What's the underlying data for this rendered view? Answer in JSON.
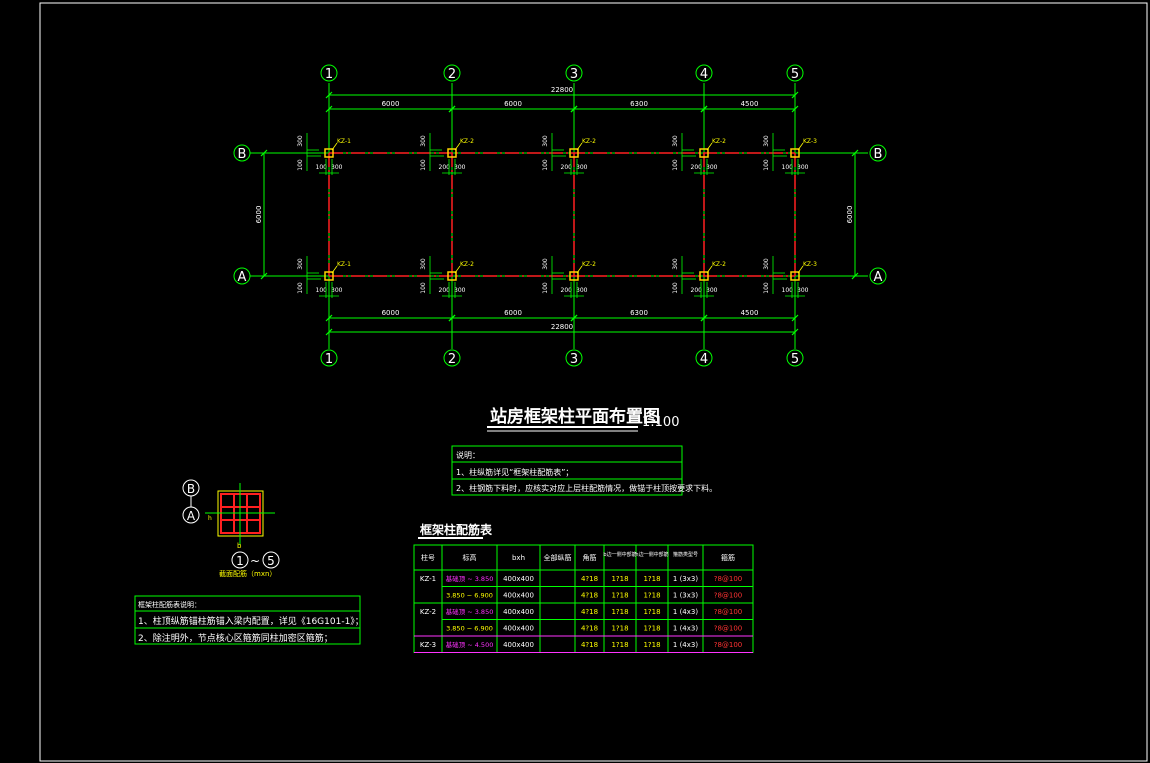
{
  "drawing": {
    "title": "站房框架柱平面布置图",
    "scale": "1:100",
    "axes_x": [
      "1",
      "2",
      "3",
      "4",
      "5"
    ],
    "axes_y": [
      "B",
      "A"
    ],
    "x_spans": [
      "6000",
      "6000",
      "6300",
      "4500"
    ],
    "x_total": "22800",
    "y_span": "6000",
    "column_labels_row": [
      "KZ-1",
      "KZ-2",
      "KZ-2",
      "KZ-2",
      "KZ-3"
    ],
    "offset_300": "300",
    "offset_100": "100",
    "offset_200": "200",
    "colors": {
      "axis": "#00ff00",
      "beam": "#ff2020",
      "column": "#ffd200",
      "label": "#ffff00",
      "text": "#ffffff",
      "pink": "#ff33ff",
      "red": "#ff3333"
    }
  },
  "notes": {
    "header": "说明：",
    "items": [
      "1、柱纵筋详见“框架柱配筋表”；",
      "2、柱钢筋下料时，应核实对应上层柱配筋情况，做锚于柱顶按要求下料。"
    ]
  },
  "legend": {
    "axis_b": "B",
    "axis_a": "A",
    "dim_h": "h",
    "dim_b": "b",
    "axis_range_from": "1",
    "axis_range_sep": "~",
    "axis_range_to": "5",
    "section_note": "截面配筋（mxn）"
  },
  "left_notes": {
    "header": "框架柱配筋表说明：",
    "items": [
      "1、柱顶纵筋锚柱筋锚入梁内配置，详见《16G101-1》；",
      "2、除注明外，节点核心区箍筋同柱加密区箍筋；"
    ]
  },
  "table": {
    "title": "框架柱配筋表",
    "headers": [
      "柱号",
      "标高",
      "bxh",
      "全部纵筋",
      "角筋",
      "b边一侧中部筋",
      "h边一侧中部筋",
      "箍筋类型号",
      "箍筋"
    ],
    "rows": [
      {
        "id": "KZ-1",
        "elev": "基础顶 ~ 3.850",
        "bxh": "400x400",
        "all": "",
        "corner": "4?18",
        "b_mid": "1?18",
        "h_mid": "1?18",
        "type": "1 (3x3)",
        "stirrup": "?8@100"
      },
      {
        "id": "",
        "elev": "3.850 ~ 6.900",
        "bxh": "400x400",
        "all": "",
        "corner": "4?18",
        "b_mid": "1?18",
        "h_mid": "1?18",
        "type": "1 (3x3)",
        "stirrup": "?8@100"
      },
      {
        "id": "KZ-2",
        "elev": "基础顶 ~ 3.850",
        "bxh": "400x400",
        "all": "",
        "corner": "4?18",
        "b_mid": "1?18",
        "h_mid": "1?18",
        "type": "1 (4x3)",
        "stirrup": "?8@100"
      },
      {
        "id": "",
        "elev": "3.850 ~ 6.900",
        "bxh": "400x400",
        "all": "",
        "corner": "4?18",
        "b_mid": "1?18",
        "h_mid": "1?18",
        "type": "1 (4x3)",
        "stirrup": "?8@100"
      },
      {
        "id": "KZ-3",
        "elev": "基础顶 ~ 4.500",
        "bxh": "400x400",
        "all": "",
        "corner": "4?18",
        "b_mid": "1?18",
        "h_mid": "1?18",
        "type": "1 (4x3)",
        "stirrup": "?8@100"
      }
    ]
  }
}
